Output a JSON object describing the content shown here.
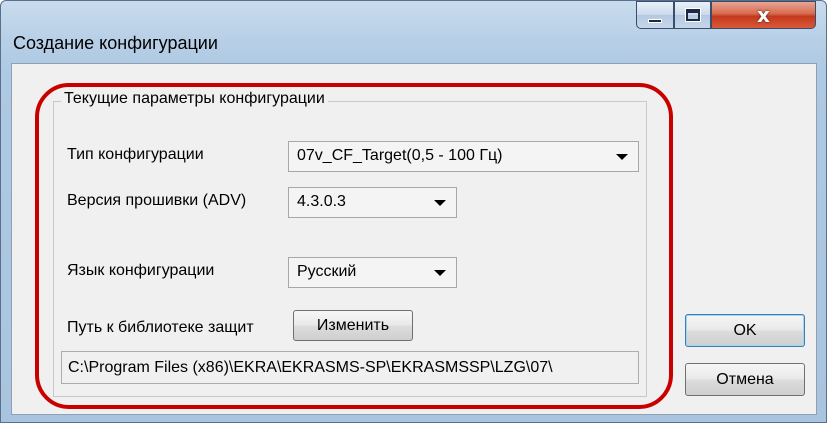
{
  "window": {
    "title": "Создание конфигурации",
    "controls": {
      "minimize": "minimize",
      "maximize": "maximize",
      "close": "x"
    }
  },
  "group": {
    "title": "Текущие параметры конфигурации",
    "config_type": {
      "label": "Тип конфигурации",
      "value": "07v_CF_Target(0,5 - 100 Гц)"
    },
    "firmware": {
      "label": "Версия прошивки (ADV)",
      "value": "4.3.0.3"
    },
    "language": {
      "label": "Язык конфигурации",
      "value": "Русский"
    },
    "library": {
      "label": "Путь к библиотеке защит",
      "change_button": "Изменить",
      "path": "C:\\Program Files (x86)\\EKRA\\EKRASMS-SP\\EKRASMSSP\\LZG\\07\\"
    }
  },
  "buttons": {
    "ok": "OK",
    "cancel": "Отмена"
  },
  "colors": {
    "highlight": "#c80000",
    "close_button": "#c4391b",
    "dialog_bg": "#f0f0f0"
  }
}
